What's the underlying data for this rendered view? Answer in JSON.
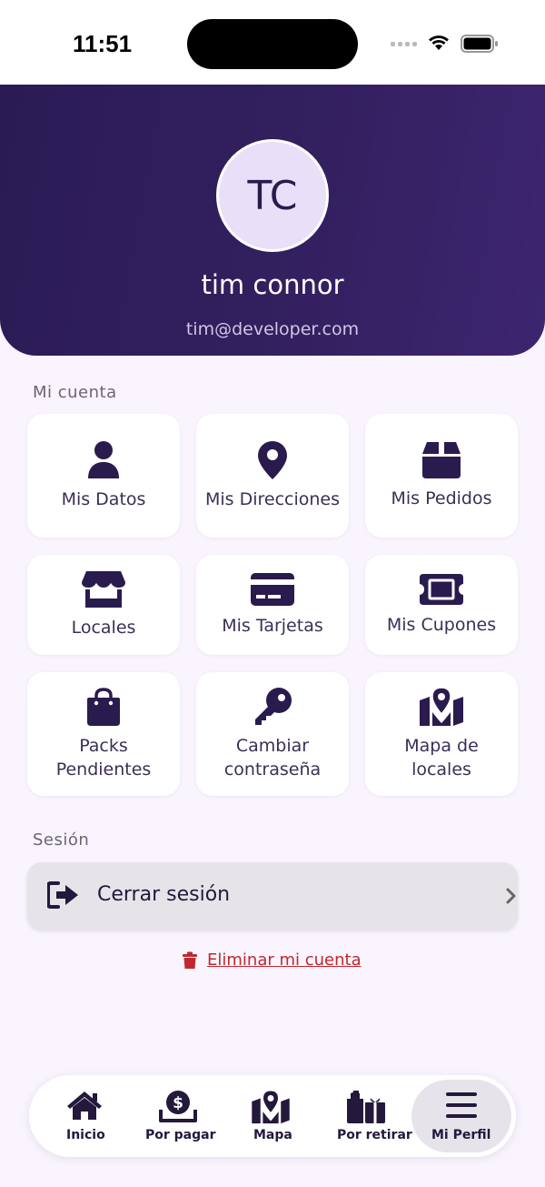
{
  "status_bar": {
    "time": "11:51"
  },
  "header": {
    "avatar_initials": "TC",
    "name": "tim connor",
    "email": "tim@developer.com"
  },
  "account_section": {
    "title": "Mi cuenta",
    "tiles": [
      {
        "label": "Mis Datos",
        "icon": "user-icon"
      },
      {
        "label": "Mis Direcciones",
        "icon": "location-pin-icon"
      },
      {
        "label": "Mis Pedidos",
        "icon": "box-icon"
      },
      {
        "label": "Locales",
        "icon": "store-icon"
      },
      {
        "label": "Mis Tarjetas",
        "icon": "credit-card-icon"
      },
      {
        "label": "Mis Cupones",
        "icon": "ticket-icon"
      },
      {
        "label": "Packs Pendientes",
        "icon": "shopping-bag-icon"
      },
      {
        "label": "Cambiar contraseña",
        "icon": "key-icon"
      },
      {
        "label": "Mapa de locales",
        "icon": "map-location-icon"
      }
    ]
  },
  "session_section": {
    "title": "Sesión",
    "logout_label": "Cerrar sesión",
    "delete_label": "Eliminar mi cuenta"
  },
  "bottom_nav": {
    "items": [
      {
        "label": "Inicio",
        "icon": "home-icon"
      },
      {
        "label": "Por pagar",
        "icon": "pay-icon"
      },
      {
        "label": "Mapa",
        "icon": "map-icon"
      },
      {
        "label": "Por retirar",
        "icon": "gift-icon"
      },
      {
        "label": "Mi Perfil",
        "icon": "menu-icon",
        "active": true
      }
    ]
  },
  "colors": {
    "primary": "#2a1b4e",
    "header_gradient_start": "#2a1b55",
    "header_gradient_end": "#3d2570",
    "background": "#f9f4fd",
    "danger": "#c0282d"
  }
}
